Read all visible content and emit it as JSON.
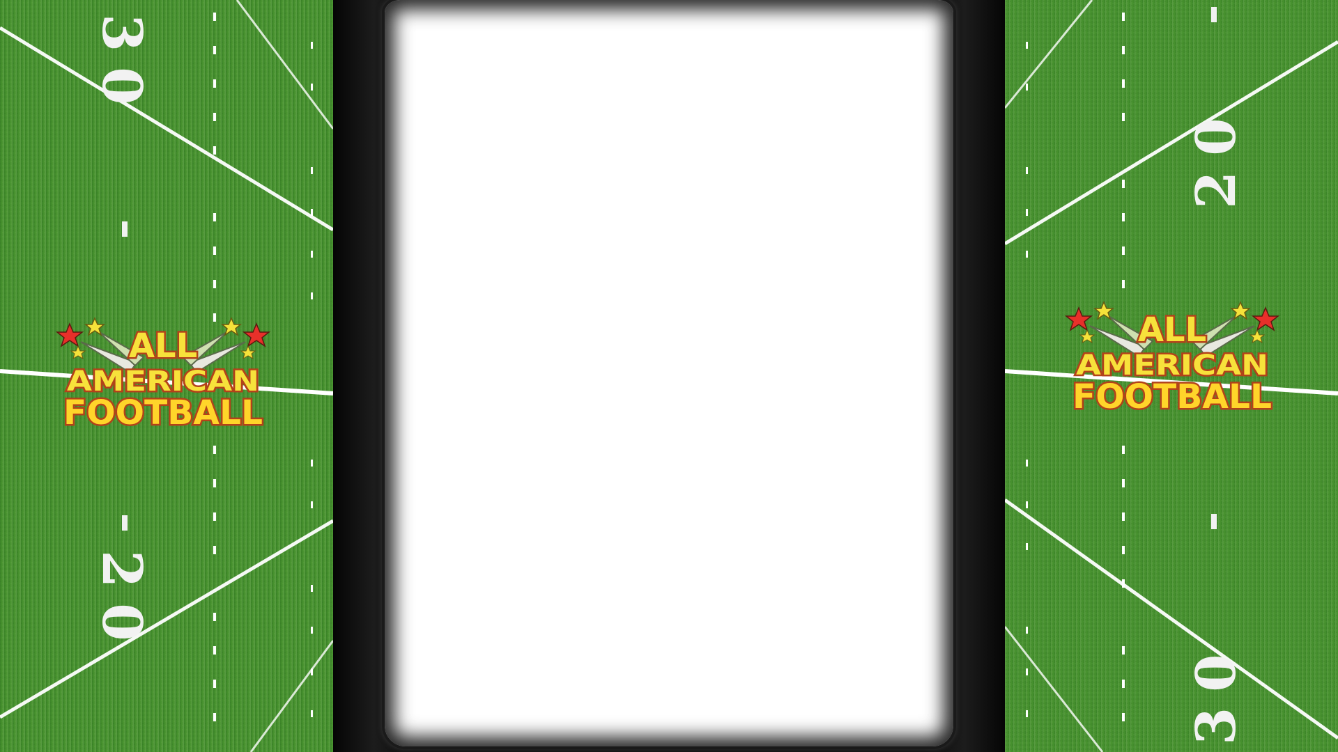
{
  "game": {
    "logo": {
      "line1": "ALL",
      "line2": "AMERICAN",
      "line3": "FOOTBALL"
    },
    "left_field": {
      "yard_top": "30",
      "yard_bottom": "20"
    },
    "right_field": {
      "yard_top": "20",
      "yard_bottom": "30"
    }
  },
  "colors": {
    "turf": "#3f8a2c",
    "turf_light": "#4e9a36",
    "yard_line": "#ffffff",
    "bezel": "#0e0e0e",
    "screen": "#ffffff",
    "logo_fill": "#f7e23b",
    "logo_outline": "#b2421a"
  }
}
